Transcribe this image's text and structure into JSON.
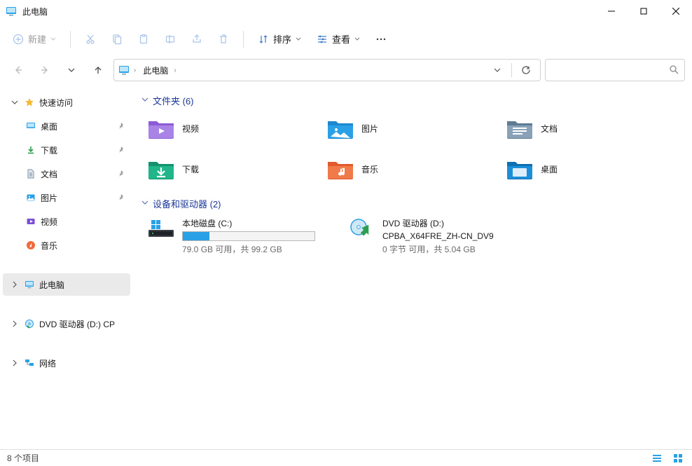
{
  "window": {
    "title": "此电脑"
  },
  "commandbar": {
    "new_label": "新建",
    "sort_label": "排序",
    "view_label": "查看"
  },
  "breadcrumb": {
    "root": "此电脑"
  },
  "sidebar": {
    "quick_access": "快速访问",
    "desktop": "桌面",
    "downloads": "下载",
    "documents": "文档",
    "pictures": "图片",
    "videos": "视频",
    "music": "音乐",
    "this_pc": "此电脑",
    "dvd": "DVD 驱动器 (D:) CP",
    "network": "网络"
  },
  "content": {
    "group_folders": "文件夹 (6)",
    "folders": {
      "videos": "视频",
      "pictures": "图片",
      "documents": "文档",
      "downloads": "下载",
      "music": "音乐",
      "desktop": "桌面"
    },
    "group_devices": "设备和驱动器 (2)",
    "drives": {
      "c": {
        "name": "本地磁盘 (C:)",
        "status": "79.0 GB 可用，共 99.2 GB",
        "fill_pct": 20
      },
      "d": {
        "name": "DVD 驱动器 (D:)",
        "subtitle": "CPBA_X64FRE_ZH-CN_DV9",
        "status": "0 字节 可用，共 5.04 GB"
      }
    }
  },
  "statusbar": {
    "items": "8 个项目"
  }
}
